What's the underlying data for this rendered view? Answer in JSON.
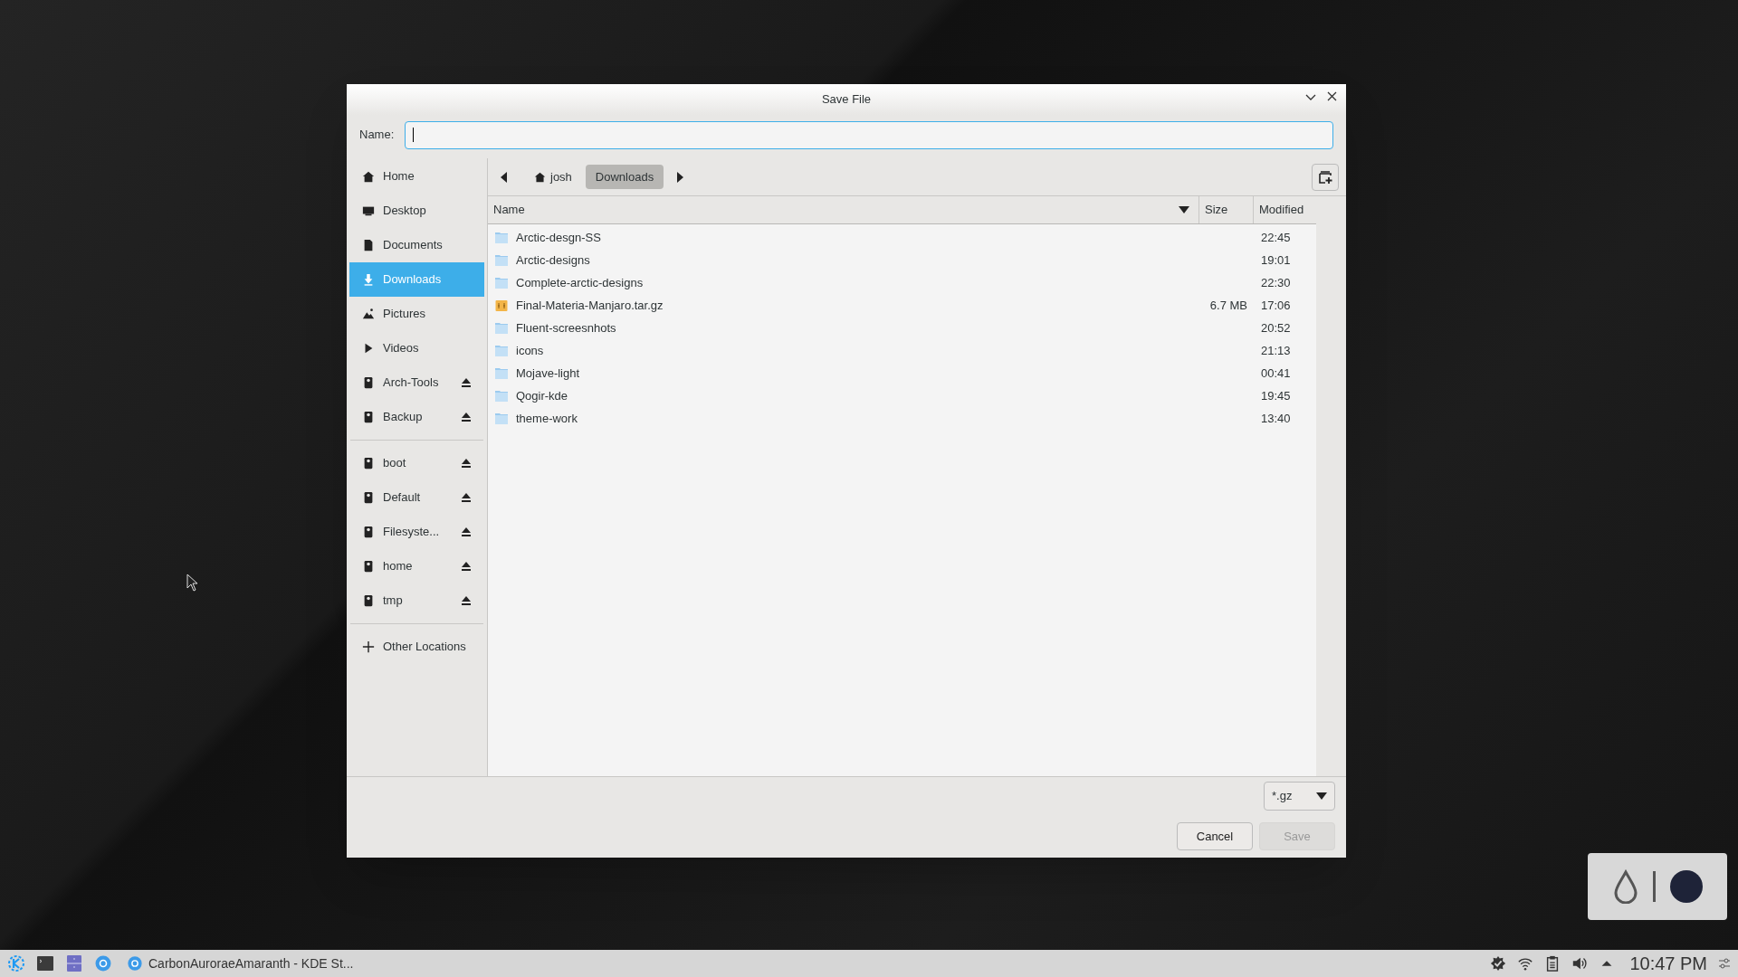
{
  "window": {
    "title": "Save File"
  },
  "name_field": {
    "label": "Name:"
  },
  "sidebar": {
    "groups": [
      [
        {
          "kind": "home",
          "label": "Home",
          "selected": false,
          "eject": false
        },
        {
          "kind": "desktop",
          "label": "Desktop",
          "selected": false,
          "eject": false
        },
        {
          "kind": "documents",
          "label": "Documents",
          "selected": false,
          "eject": false
        },
        {
          "kind": "downloads",
          "label": "Downloads",
          "selected": true,
          "eject": false
        },
        {
          "kind": "pictures",
          "label": "Pictures",
          "selected": false,
          "eject": false
        },
        {
          "kind": "videos",
          "label": "Videos",
          "selected": false,
          "eject": false
        },
        {
          "kind": "drive",
          "label": "Arch-Tools",
          "selected": false,
          "eject": true
        },
        {
          "kind": "drive",
          "label": "Backup",
          "selected": false,
          "eject": true
        }
      ],
      [
        {
          "kind": "drive",
          "label": "boot",
          "selected": false,
          "eject": true
        },
        {
          "kind": "drive",
          "label": "Default",
          "selected": false,
          "eject": true
        },
        {
          "kind": "drive",
          "label": "Filesyste...",
          "selected": false,
          "eject": true
        },
        {
          "kind": "drive",
          "label": "home",
          "selected": false,
          "eject": true
        },
        {
          "kind": "drive",
          "label": "tmp",
          "selected": false,
          "eject": true
        }
      ],
      [
        {
          "kind": "other",
          "label": "Other Locations",
          "selected": false,
          "eject": false
        }
      ]
    ]
  },
  "path_bar": {
    "segments": [
      {
        "kind": "home",
        "label": "josh",
        "selected": false
      },
      {
        "kind": "folder",
        "label": "Downloads",
        "selected": true
      }
    ]
  },
  "table": {
    "columns": [
      "Name",
      "Size",
      "Modified"
    ],
    "rows": [
      {
        "kind": "folder",
        "name": "Arctic-desgn-SS",
        "modified": "22:45"
      },
      {
        "kind": "folder",
        "name": "Arctic-designs",
        "modified": "19:01"
      },
      {
        "kind": "folder",
        "name": "Complete-arctic-designs",
        "modified": "22:30"
      },
      {
        "kind": "archive",
        "name": "Final-Materia-Manjaro.tar.gz",
        "size": "6.7 MB",
        "modified": "17:06"
      },
      {
        "kind": "folder",
        "name": "Fluent-screesnhots",
        "modified": "20:52"
      },
      {
        "kind": "folder",
        "name": "icons",
        "modified": "21:13"
      },
      {
        "kind": "folder",
        "name": "Mojave-light",
        "modified": "00:41"
      },
      {
        "kind": "folder",
        "name": "Qogir-kde",
        "modified": "19:45"
      },
      {
        "kind": "folder",
        "name": "theme-work",
        "modified": "13:40"
      }
    ]
  },
  "filter": {
    "value": "*.gz"
  },
  "buttons": [
    {
      "label": "Cancel",
      "disabled": false
    },
    {
      "label": "Save",
      "disabled": true
    }
  ],
  "taskbar": {
    "launchers": [
      {
        "kind": "kde"
      },
      {
        "kind": "terminal"
      },
      {
        "kind": "files"
      },
      {
        "kind": "browser"
      }
    ],
    "tasks": [
      {
        "label": "CarbonAuroraeAmaranth - KDE St..."
      }
    ],
    "tray": [
      {
        "kind": "updates"
      },
      {
        "kind": "wifi"
      },
      {
        "kind": "clipboard"
      },
      {
        "kind": "volume"
      },
      {
        "kind": "expand"
      }
    ],
    "clock": "10:47 PM"
  }
}
